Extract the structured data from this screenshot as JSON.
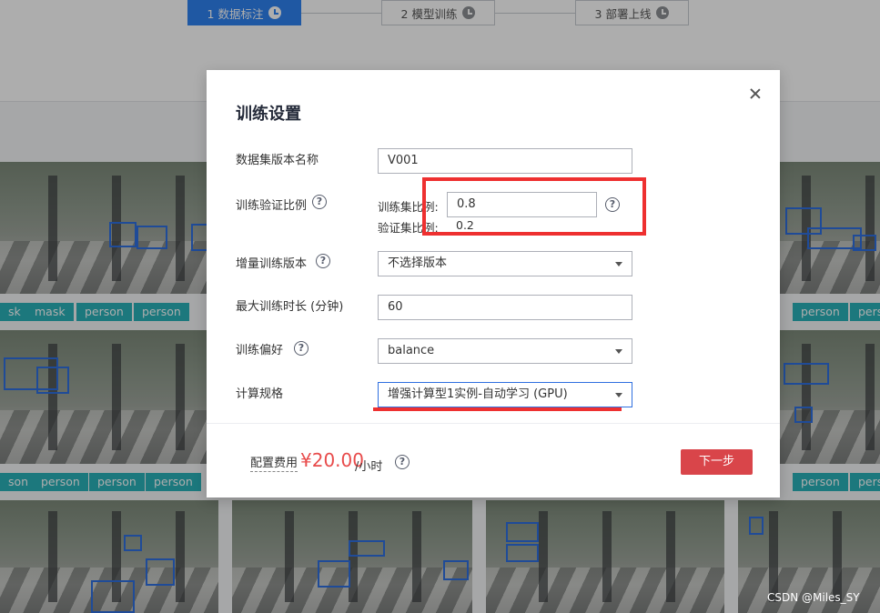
{
  "steps": [
    {
      "label": "1 数据标注",
      "active": true
    },
    {
      "label": "2 模型训练",
      "active": false
    },
    {
      "label": "3 部署上线",
      "active": false
    }
  ],
  "tags_row1": [
    "sk",
    "mask",
    "person",
    "person",
    "person",
    "perso"
  ],
  "tags_row2": [
    "son",
    "person",
    "person",
    "person",
    "person",
    "perso"
  ],
  "dialog": {
    "title": "训练设置",
    "dataset_version_label": "数据集版本名称",
    "dataset_version_value": "V001",
    "split_label": "训练验证比例",
    "train_ratio_label": "训练集比例:",
    "train_ratio_value": "0.8",
    "val_ratio_label": "验证集比例:",
    "val_ratio_value": "0.2",
    "incremental_label": "增量训练版本",
    "incremental_value": "不选择版本",
    "max_time_label": "最大训练时长 (分钟)",
    "max_time_value": "60",
    "preference_label": "训练偏好",
    "preference_value": "balance",
    "spec_label": "计算规格",
    "spec_value": "增强计算型1实例-自动学习 (GPU)",
    "fee_label": "配置费用",
    "fee_amount": "¥20.00",
    "fee_unit": "/小时",
    "next_label": "下一步",
    "help_glyph": "?"
  },
  "watermark": "CSDN @Miles_SY"
}
